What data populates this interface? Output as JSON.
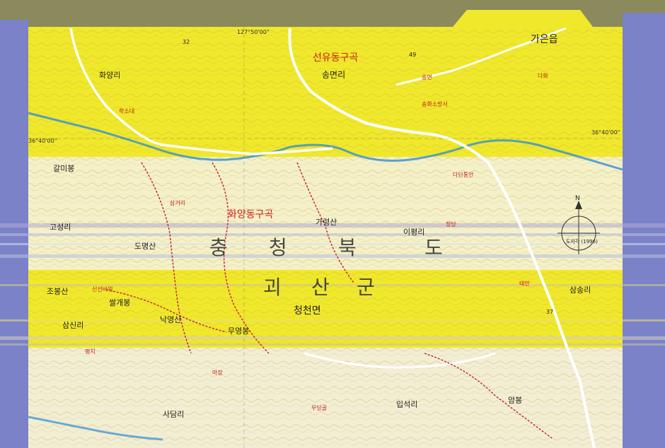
{
  "map": {
    "province": [
      "충",
      "청",
      "북",
      "도"
    ],
    "county": [
      "괴",
      "산",
      "군"
    ],
    "towns": {
      "cheongcheon_myeon": "청천면",
      "garyeong_myeon": "가은읍"
    },
    "valleys": {
      "seonyu": "선유동구곡",
      "hwayang": "화양동구곡"
    },
    "villages": {
      "hwayang_ri": "화양리",
      "songmyeon_ri": "송면리",
      "goseong_ri": "고성리",
      "ipyeong_ri": "이평리",
      "samsong_ri": "삼송리",
      "sinsin_ri": "삼신리",
      "sadam_ri": "사담리",
      "ipseok_ri": "입석리",
      "ammong": "암봉"
    },
    "peaks": {
      "galmibong": "갈미봉",
      "doseongsan": "도명산",
      "garyeongsan": "가령산",
      "jobongsan": "조봉산",
      "ssaegaebong": "쌀개봉",
      "nakyeongsan": "낙영산",
      "muyeongbong": "무영봉"
    },
    "places": {
      "hakseomdae": "학소대",
      "jeongdang": "정당",
      "samgeori": "삼거리",
      "pyeongji": "평지",
      "soghomat": "송면",
      "songhwasosang": "송화소방서",
      "dantongan": "다단통안",
      "tae": "태안",
      "dahwa": "다화",
      "majang": "마장",
      "sinseon": "신선바위",
      "mg": "무당골"
    },
    "grid": {
      "lat": "36°40'00\"",
      "lat_right": "36°40'00\"",
      "lon": "127°50'00\""
    },
    "routes": [
      "32",
      "49",
      "37"
    ],
    "compass": {
      "north": "N",
      "decl": "도자각 (1996)"
    },
    "colors": {
      "yellow": "#f0e82a",
      "pale": "#f4f0c8",
      "blue": "#7b82c8",
      "border": "#8a8a5c",
      "road": "#e8f0f0",
      "trail": "#c02040",
      "river": "#2f8fd8"
    }
  }
}
